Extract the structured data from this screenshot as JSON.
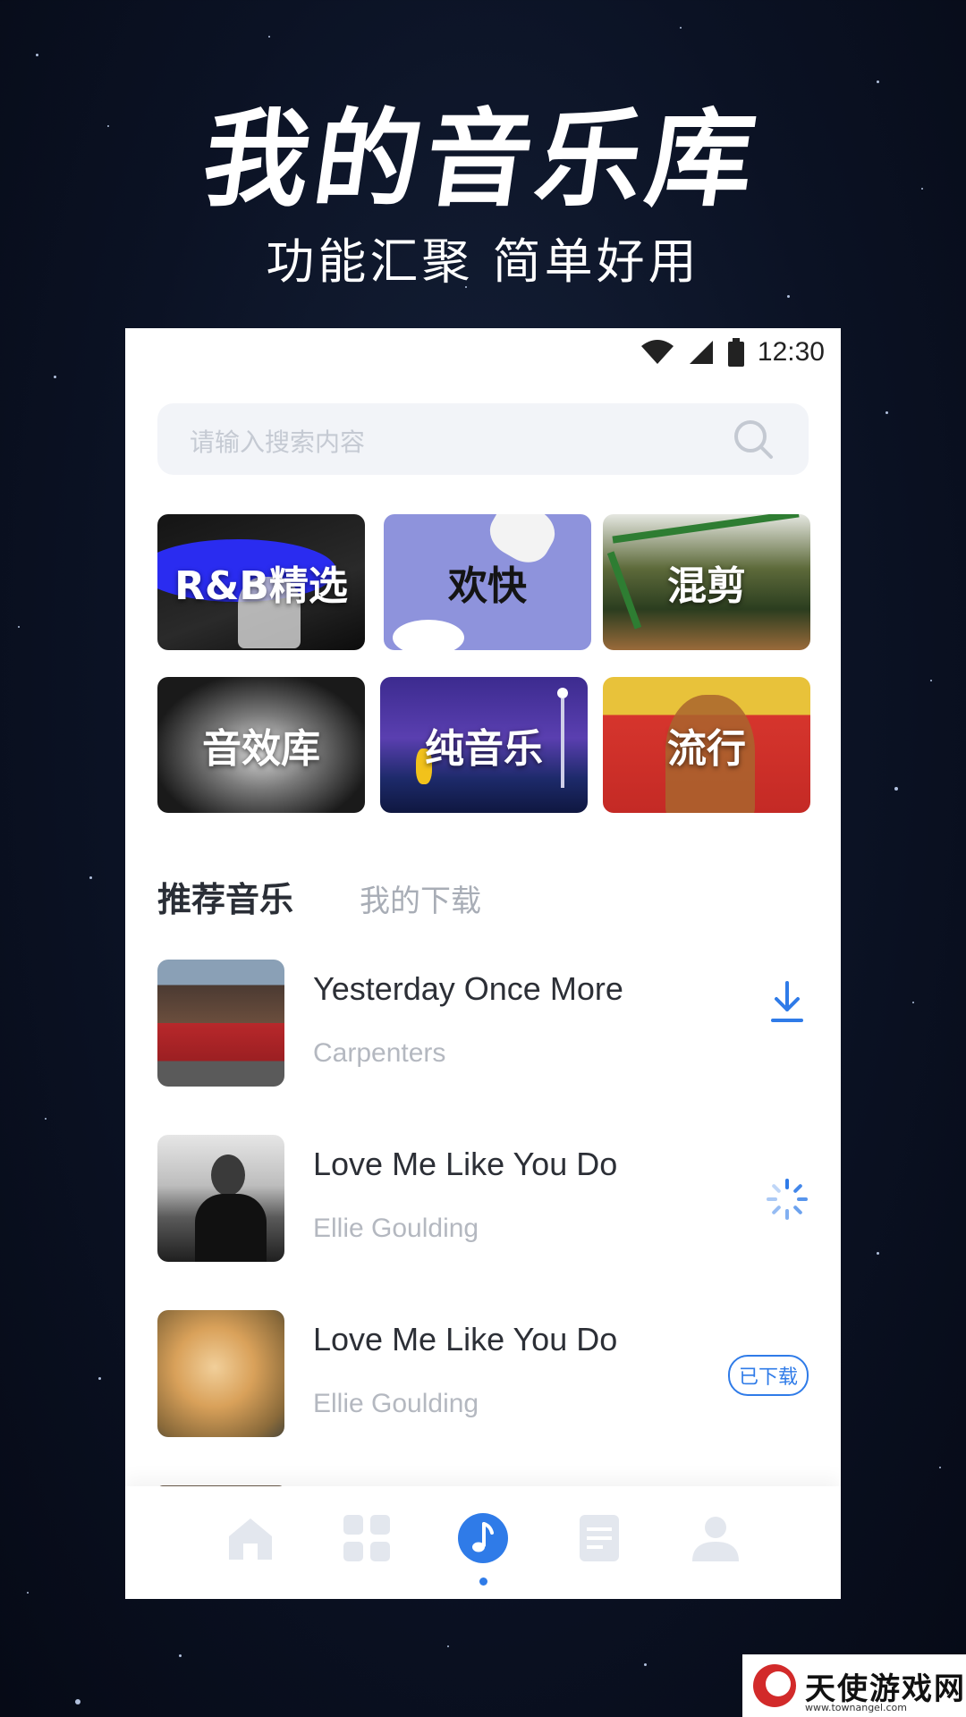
{
  "hero": {
    "title": "我的音乐库",
    "subtitle": "功能汇聚 简单好用"
  },
  "status": {
    "time": "12:30"
  },
  "search": {
    "placeholder": "请输入搜索内容"
  },
  "categories": [
    {
      "label": "R&B精选"
    },
    {
      "label": "欢快"
    },
    {
      "label": "混剪"
    },
    {
      "label": "音效库"
    },
    {
      "label": "纯音乐"
    },
    {
      "label": "流行"
    }
  ],
  "tabs": {
    "active": "推荐音乐",
    "inactive": "我的下载"
  },
  "songs": [
    {
      "title": "Yesterday Once More",
      "artist": "Carpenters",
      "status": "download"
    },
    {
      "title": "Love Me Like You Do",
      "artist": "Ellie  Goulding",
      "status": "loading"
    },
    {
      "title": "Love Me Like You Do",
      "artist": "Ellie  Goulding",
      "status": "downloaded",
      "badge": "已下载"
    }
  ],
  "nav": {
    "items": [
      "home-icon",
      "grid-icon",
      "music-note-icon",
      "document-icon",
      "user-icon"
    ],
    "active_index": 2
  },
  "watermark": {
    "text": "天使游戏网",
    "url": "www.townangel.com"
  },
  "colors": {
    "accent": "#2f7be8",
    "background": "#0b1224"
  }
}
